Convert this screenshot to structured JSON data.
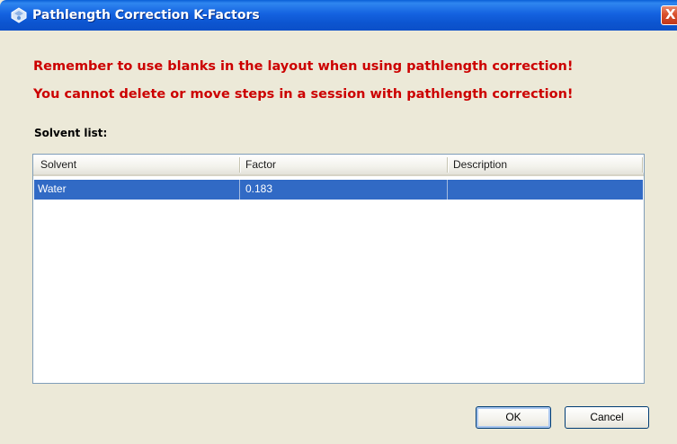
{
  "window": {
    "title": "Pathlength Correction K-Factors",
    "close_glyph": "X"
  },
  "warnings": [
    "Remember to use blanks in the layout when using pathlength correction!",
    "You cannot delete or move steps in a session with pathlength correction!"
  ],
  "solvent_list": {
    "label": "Solvent list:",
    "columns": [
      "Solvent",
      "Factor",
      "Description"
    ],
    "rows": [
      {
        "solvent": "Water",
        "factor": "0.183",
        "description": "",
        "selected": true
      }
    ]
  },
  "buttons": {
    "ok": "OK",
    "cancel": "Cancel"
  },
  "colors": {
    "warning_text": "#cc0000",
    "selection": "#316ac5",
    "titlebar": "#0c55d0"
  },
  "icons": {
    "title": "app-icon",
    "close": "close-icon"
  }
}
